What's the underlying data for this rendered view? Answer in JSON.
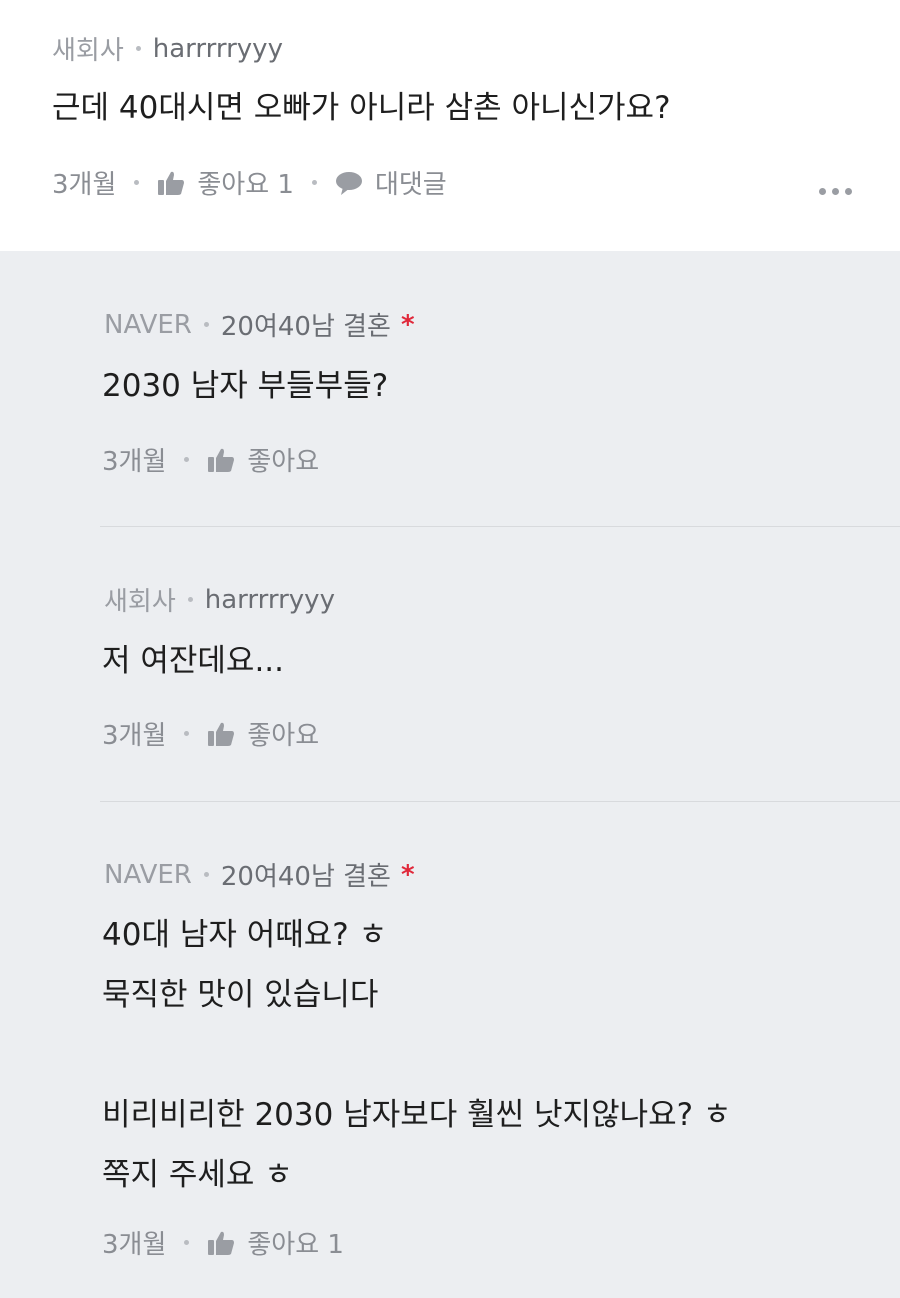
{
  "comment": {
    "source": "새회사",
    "author": "harrrrryyy",
    "text": "근데 40대시면 오빠가 아니라 삼촌 아니신가요?",
    "time": "3개월",
    "like_label": "좋아요 1",
    "reply_label": "대댓글"
  },
  "replies": [
    {
      "source": "NAVER",
      "author": "20여40남 결혼",
      "author_mark": "*",
      "lines": [
        "2030 남자 부들부들?"
      ],
      "time": "3개월",
      "like_label": "좋아요"
    },
    {
      "source": "새회사",
      "author": "harrrrryyy",
      "lines": [
        "저 여잔데요..."
      ],
      "time": "3개월",
      "like_label": "좋아요"
    },
    {
      "source": "NAVER",
      "author": "20여40남 결혼",
      "author_mark": "*",
      "lines": [
        "40대 남자 어때요? ㅎ",
        "묵직한 맛이 있습니다",
        "",
        "비리비리한 2030 남자보다 훨씬 낫지않나요? ㅎ",
        "쪽지 주세요 ㅎ"
      ],
      "time": "3개월",
      "like_label": "좋아요 1"
    }
  ],
  "icons": {
    "like": "thumbs-up-icon",
    "reply": "speech-bubble-icon",
    "more": "more-dots-icon"
  },
  "colors": {
    "top_background": "#ffffff",
    "reply_background": "#eceef1",
    "author_mark": "#e0283a"
  }
}
